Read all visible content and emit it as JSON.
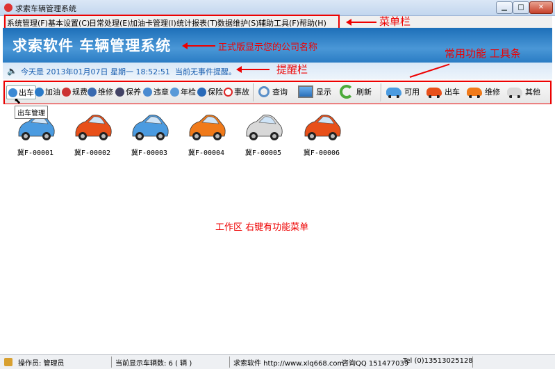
{
  "window": {
    "title": "求索车辆管理系统",
    "min": "▁",
    "max": "□",
    "close": "✕"
  },
  "menubar": {
    "items": [
      "系统管理(F)",
      "基本设置(C)",
      "日常处理(E)",
      "加油卡管理(I)",
      "统计报表(T)",
      "数据维护(S)",
      "辅助工具(F)",
      "帮助(H)"
    ]
  },
  "banner": {
    "title": "求索软件  车辆管理系统"
  },
  "reminder": {
    "date_text": "今天是  2013年01月07日  星期一  18:52:51",
    "event_text": "当前无事件提醒。"
  },
  "toolbar": {
    "small": [
      "出车",
      "加油",
      "规费",
      "维修",
      "保养",
      "违章",
      "年检",
      "保险",
      "事故"
    ],
    "big": [
      "查询",
      "显示",
      "刷新"
    ],
    "status": [
      "可用",
      "出车",
      "维修",
      "其他"
    ]
  },
  "tooltip": "出车管理",
  "vehicles": [
    {
      "plate": "冀F-00001",
      "color": "#4b9be0"
    },
    {
      "plate": "冀F-00002",
      "color": "#e8501a"
    },
    {
      "plate": "冀F-00003",
      "color": "#4b9be0"
    },
    {
      "plate": "冀F-00004",
      "color": "#f07a1a"
    },
    {
      "plate": "冀F-00005",
      "color": "#d8d8d8"
    },
    {
      "plate": "冀F-00006",
      "color": "#e8501a"
    }
  ],
  "annotations": {
    "menubar": "菜单栏",
    "company": "正式版显示您的公司名称",
    "toolbar": "常用功能 工具条",
    "reminder": "提醒栏",
    "workarea": "工作区  右键有功能菜单"
  },
  "statusbar": {
    "operator": "操作员: 管理员",
    "count": "当前显示车辆数: 6 ( 辆 )",
    "brand": "求索软件  http://www.xlq668.com",
    "qq": "咨询QQ 151477039",
    "tel": "Tel  (0)13513025128"
  },
  "colors": {
    "accent": "#1d6fb8",
    "annotation": "#e00000"
  }
}
